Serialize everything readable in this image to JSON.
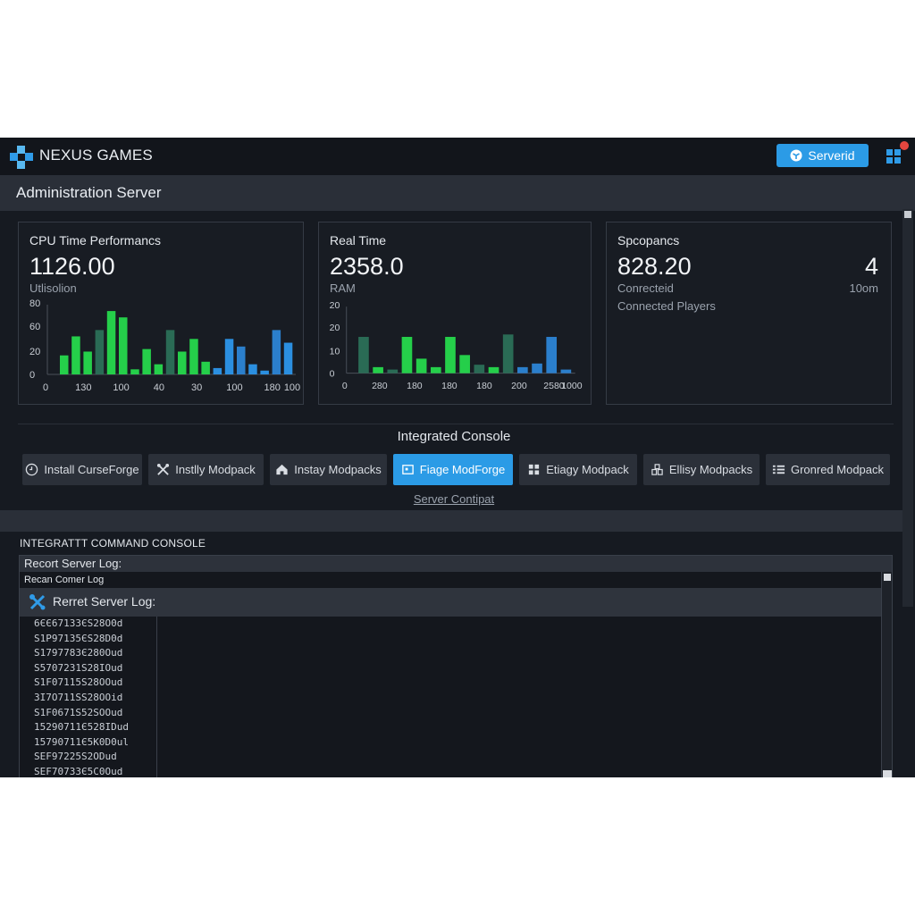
{
  "header": {
    "brand": "NEXUS GAMES",
    "server_button": "Serverid"
  },
  "page": {
    "title": "Administration Server"
  },
  "cards": [
    {
      "title": "CPU Time Performancs",
      "value": "1126.00",
      "sub": "Utlisolion",
      "chart_data": {
        "type": "bar",
        "y_ticks": [
          "0",
          "20",
          "60",
          "80"
        ],
        "x_ticks": [
          "0",
          "130",
          "100",
          "40",
          "30",
          "100",
          "180",
          "100"
        ],
        "values": [
          15,
          30,
          18,
          35,
          50,
          45,
          4,
          20,
          8,
          35,
          18,
          28,
          10,
          5,
          28,
          22,
          8,
          3,
          35,
          25
        ],
        "colors": [
          "#25cf4a",
          "#25cf4a",
          "#25cf4a",
          "#2a6b55",
          "#25cf4a",
          "#25cf4a",
          "#25cf4a",
          "#25cf4a",
          "#25cf4a",
          "#2a6b55",
          "#25cf4a",
          "#25cf4a",
          "#25cf4a",
          "#2b8fe0",
          "#2b8fe0",
          "#2b7fcc",
          "#2b8fe0",
          "#2b8fe0",
          "#2b7fcc",
          "#2b8fe0"
        ]
      }
    },
    {
      "title": "Real Time",
      "value": "2358.0",
      "sub": "RAM",
      "chart_data": {
        "type": "bar",
        "y_ticks": [
          "0",
          "10",
          "20",
          "20"
        ],
        "x_ticks": [
          "0",
          "280",
          "180",
          "180",
          "180",
          "200",
          "2580",
          "1000"
        ],
        "values": [
          30,
          5,
          3,
          30,
          12,
          5,
          30,
          15,
          7,
          5,
          32,
          5,
          8,
          30,
          3
        ],
        "colors": [
          "#2a6b55",
          "#25cf4a",
          "#2a6b55",
          "#25cf4a",
          "#25cf4a",
          "#25cf4a",
          "#25cf4a",
          "#25cf4a",
          "#2a6b55",
          "#25cf4a",
          "#2a6b55",
          "#2b7fcc",
          "#2b7fcc",
          "#2b7fcc",
          "#2b7fcc"
        ]
      }
    },
    {
      "title": "Spcopancs",
      "value": "828.20",
      "sub": "Conrecteid",
      "sub2": "Connected Players",
      "right_value": "4",
      "right_sub": "10om"
    }
  ],
  "console": {
    "heading": "Integrated Console",
    "actions": [
      {
        "label": "Install CurseForge",
        "icon": "clock-icon",
        "active": false
      },
      {
        "label": "Instlly Modpack",
        "icon": "tools-icon",
        "active": false
      },
      {
        "label": "Instay Modpacks",
        "icon": "home-icon",
        "active": false
      },
      {
        "label": "Fiage ModForge",
        "icon": "frame-icon",
        "active": true
      },
      {
        "label": "Etiagy Modpack",
        "icon": "grid-icon",
        "active": false
      },
      {
        "label": "Ellisy Modpacks",
        "icon": "blocks-icon",
        "active": false
      },
      {
        "label": "Gronred Modpack",
        "icon": "list-icon",
        "active": false
      }
    ],
    "compat_link": "Server Contipat",
    "command_label": "INTEGRATTT COMMAND CONSOLE",
    "log_title": "Recort Server Log:",
    "log_sub": "Recan Comer Log",
    "log_strip_title": "Rerret Server Log:",
    "log_lines": [
      "6ЄЄ67133ЄS28O0d",
      "S1P97135ЄS28D0d",
      "S1797783Є280Oud",
      "S5707231S28IOud",
      "S1F07115S28OOud",
      "3I7O711SS28OOid",
      "S1F0671S52SOOud",
      "15290711Є528IDud",
      "15790711Є5K0D0ul",
      "SEF97225S2ODud",
      "SEF70733Є5C0Oud"
    ]
  }
}
